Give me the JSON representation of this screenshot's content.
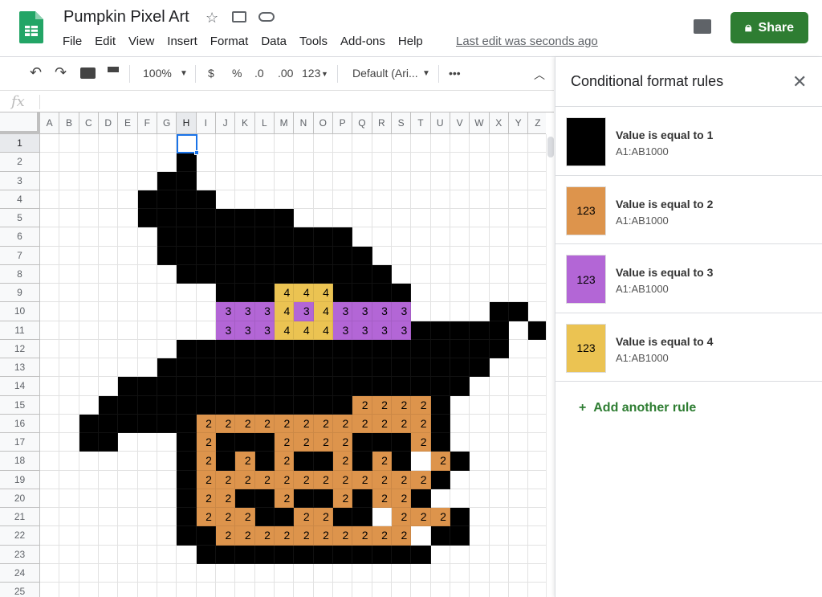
{
  "doc": {
    "title": "Pumpkin Pixel Art",
    "last_edit": "Last edit was seconds ago",
    "share_label": "Share"
  },
  "menu": [
    "File",
    "Edit",
    "View",
    "Insert",
    "Format",
    "Data",
    "Tools",
    "Add-ons",
    "Help"
  ],
  "toolbar": {
    "zoom": "100%",
    "currency": "$",
    "percent": "%",
    "dec_less": ".0",
    "dec_more": ".00",
    "format_more": "123",
    "font": "Default (Ari...",
    "more": "•••"
  },
  "formula_bar": {
    "label": "fx",
    "value": ""
  },
  "sheet": {
    "columns": [
      "A",
      "B",
      "C",
      "D",
      "E",
      "F",
      "G",
      "H",
      "I",
      "J",
      "K",
      "L",
      "M",
      "N",
      "O",
      "P",
      "Q",
      "R",
      "S",
      "T",
      "U",
      "V",
      "W",
      "X",
      "Y",
      "Z"
    ],
    "selected_cell": "H1",
    "rows": [
      "",
      ".......1",
      "......11",
      ".....1111",
      ".....11111111",
      "......1111111111",
      "......11111111111",
      ".......11111111111",
      ".........1114441111",
      ".........3334343333....11",
      ".........333444333311111 1",
      ".......11111111111111111",
      "......11111111111111111",
      "....111111111111111111",
      "...111111111111122221",
      "..1111112222222222221",
      "..11...12111222211121",
      ".......121212112121 21",
      ".......12222222222221",
      ".......1221121121221",
      ".......1222112211 2221",
      ".......112222222222 11",
      "........111111111111",
      "",
      ""
    ]
  },
  "colors": {
    "1": "#000000",
    "2": "#dd944c",
    "3": "#b366d6",
    "4": "#ebc352",
    "accent": "#2e7d32",
    "selection": "#1a73e8"
  },
  "panel": {
    "title": "Conditional format rules",
    "rules": [
      {
        "condition": "Value is equal to 1",
        "range": "A1:AB1000",
        "preview": "",
        "fill": "#000000"
      },
      {
        "condition": "Value is equal to 2",
        "range": "A1:AB1000",
        "preview": "123",
        "fill": "#dd944c"
      },
      {
        "condition": "Value is equal to 3",
        "range": "A1:AB1000",
        "preview": "123",
        "fill": "#b366d6"
      },
      {
        "condition": "Value is equal to 4",
        "range": "A1:AB1000",
        "preview": "123",
        "fill": "#ebc352"
      }
    ],
    "add_rule": "Add another rule"
  }
}
